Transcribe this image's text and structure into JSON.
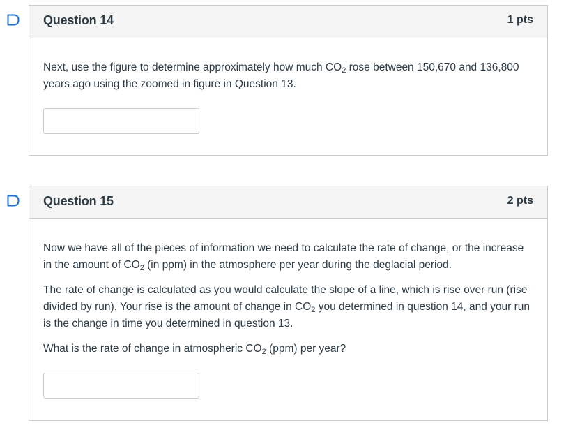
{
  "questions": [
    {
      "title": "Question 14",
      "points": "1 pts",
      "text_parts": {
        "a": "Next, use the figure to determine approximately how much CO",
        "sub": "2",
        "b": " rose between 150,670 and 136,800 years ago using the zoomed in figure in Question 13."
      },
      "answer_value": ""
    },
    {
      "title": "Question 15",
      "points": "2 pts",
      "p1": {
        "a": "Now we have all of the pieces of information we need to calculate the rate of change, or the increase in the amount of CO",
        "sub": "2",
        "b": " (in ppm) in the atmosphere per year during the deglacial period."
      },
      "p2": {
        "a": "The rate of change is calculated as you would calculate the slope of a line, which is rise over run (rise divided by run). Your rise is the amount of change in CO",
        "sub": "2",
        "b": " you determined in question 14, and your run is the change in time you determined in question 13."
      },
      "p3": {
        "a": "What is the rate of change in atmospheric CO",
        "sub": "2",
        "b": " (ppm) per year?"
      },
      "answer_value": ""
    }
  ],
  "icons": {
    "flag": "flag-bookmark-icon"
  },
  "colors": {
    "accent": "#1f6fd0",
    "text": "#2d3b45",
    "header_bg": "#f5f5f5",
    "border": "#c7cdd1"
  }
}
